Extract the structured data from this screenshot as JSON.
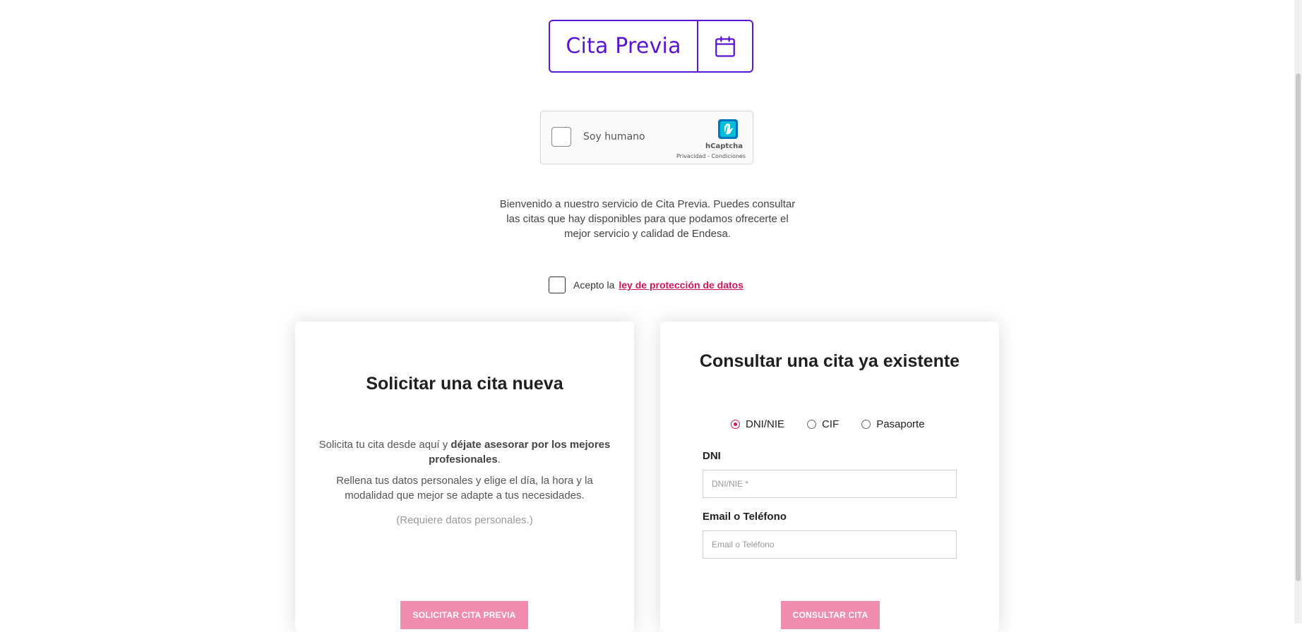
{
  "brand": {
    "title": "Cita Previa",
    "icon": "calendar-icon",
    "accent_color": "#5a14d7"
  },
  "captcha": {
    "label": "Soy humano",
    "brand": "hCaptcha",
    "links": "Privacidad - Condiciones",
    "icon": "hcaptcha-logo-icon"
  },
  "intro": {
    "text": "Bienvenido a nuestro servicio de Cita Previa. Puedes consultar las citas que hay disponibles para que podamos ofrecerte el mejor servicio y calidad de Endesa."
  },
  "consent": {
    "prefix": "Acepto la",
    "link": "ley de protección de datos",
    "link_color": "#d4145a"
  },
  "new_appointment": {
    "title": "Solicitar una cita nueva",
    "desc_prefix": "Solicita tu cita desde aquí y ",
    "desc_bold": "déjate asesorar por los mejores profesionales",
    "desc_suffix": ".",
    "desc2": "Rellena tus datos personales y elige el día, la hora y la modalidad que mejor se adapte a tus necesidades.",
    "note": "(Requiere datos personales.)",
    "button": "SOLICITAR CITA PREVIA",
    "button_color": "#f08cae"
  },
  "existing_appointment": {
    "title": "Consultar una cita ya existente",
    "doc_types": [
      "DNI/NIE",
      "CIF",
      "Pasaporte"
    ],
    "selected_doc_type": "DNI/NIE",
    "dni_label": "DNI",
    "dni_placeholder": "DNI/NIE *",
    "contact_label": "Email o Teléfono",
    "contact_placeholder": "Email o Teléfono",
    "button": "CONSULTAR CITA"
  }
}
